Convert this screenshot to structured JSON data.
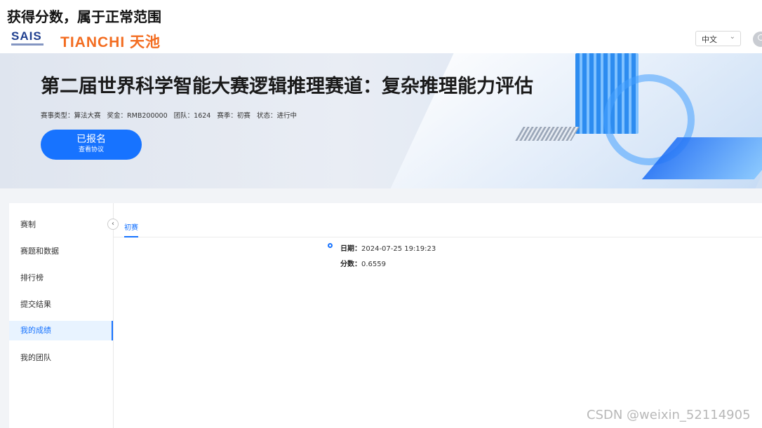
{
  "caption": "获得分数，属于正常范围",
  "header": {
    "logo_sais": "SAIS",
    "logo_tianchi": "TIANCHI 天池",
    "language": "中文"
  },
  "banner": {
    "title": "第二届世界科学智能大赛逻辑推理赛道：复杂推理能力评估",
    "meta": {
      "type": "赛事类型：算法大赛",
      "prize": "奖金：RMB200000",
      "teams": "团队：1624",
      "season": "赛季：初赛",
      "status": "状态：进行中"
    },
    "register_button": {
      "label": "已报名",
      "sub_label": "查看协议"
    }
  },
  "sidebar": {
    "items": [
      {
        "label": "赛制"
      },
      {
        "label": "赛题和数据"
      },
      {
        "label": "排行榜"
      },
      {
        "label": "提交结果"
      },
      {
        "label": "我的成绩"
      },
      {
        "label": "我的团队"
      }
    ],
    "active_index": 4
  },
  "main": {
    "tabs": [
      {
        "label": "初赛"
      }
    ],
    "record": {
      "date_label": "日期：",
      "date_value": "2024-07-25 19:19:23",
      "score_label": "分数：",
      "score_value": "0.6559"
    }
  },
  "watermark": "CSDN @weixin_52114905",
  "colors": {
    "accent": "#1773ff",
    "brand_orange": "#f36d21"
  }
}
